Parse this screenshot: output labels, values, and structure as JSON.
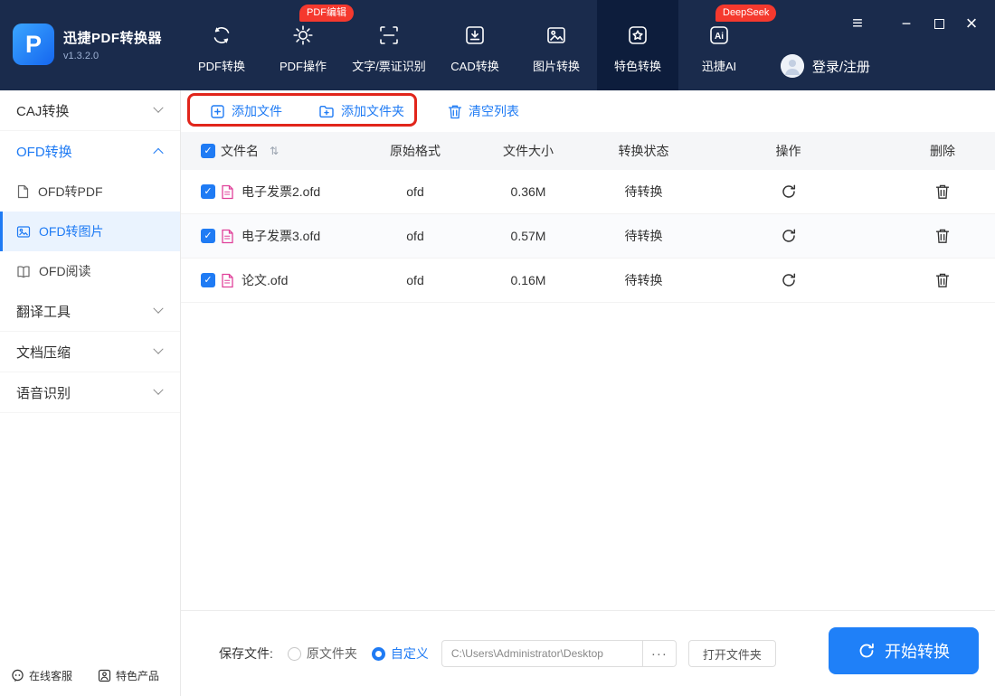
{
  "app": {
    "name": "迅捷PDF转换器",
    "version": "v1.3.2.0",
    "logo_letter": "P"
  },
  "header": {
    "nav": [
      {
        "label": "PDF转换"
      },
      {
        "label": "PDF操作",
        "badge": "PDF编辑"
      },
      {
        "label": "文字/票证识别"
      },
      {
        "label": "CAD转换"
      },
      {
        "label": "图片转换"
      },
      {
        "label": "特色转换",
        "active": true
      },
      {
        "label": "迅捷AI",
        "badge": "DeepSeek"
      }
    ],
    "login": "登录/注册"
  },
  "sidebar": {
    "groups": [
      {
        "label": "CAJ转换",
        "state": "collapsed"
      },
      {
        "label": "OFD转换",
        "state": "expanded",
        "children": [
          {
            "label": "OFD转PDF"
          },
          {
            "label": "OFD转图片",
            "active": true
          },
          {
            "label": "OFD阅读"
          }
        ]
      },
      {
        "label": "翻译工具",
        "state": "collapsed"
      },
      {
        "label": "文档压缩",
        "state": "collapsed"
      },
      {
        "label": "语音识别",
        "state": "collapsed"
      }
    ],
    "footer": [
      {
        "label": "在线客服"
      },
      {
        "label": "特色产品"
      }
    ]
  },
  "toolbar": {
    "add_file": "添加文件",
    "add_folder": "添加文件夹",
    "clear_list": "清空列表"
  },
  "table": {
    "columns": {
      "name": "文件名",
      "format": "原始格式",
      "size": "文件大小",
      "status": "转换状态",
      "action": "操作",
      "delete": "删除"
    },
    "rows": [
      {
        "name": "电子发票2.ofd",
        "format": "ofd",
        "size": "0.36M",
        "status": "待转换",
        "checked": true
      },
      {
        "name": "电子发票3.ofd",
        "format": "ofd",
        "size": "0.57M",
        "status": "待转换",
        "checked": true
      },
      {
        "name": "论文.ofd",
        "format": "ofd",
        "size": "0.16M",
        "status": "待转换",
        "checked": true
      }
    ]
  },
  "footer_bar": {
    "save_label": "保存文件:",
    "radio_original": "原文件夹",
    "radio_custom": "自定义",
    "path_value": "C:\\Users\\Administrator\\Desktop",
    "more_button": "···",
    "open_folder": "打开文件夹",
    "start_button": "开始转换"
  },
  "icons": {
    "check": "✓",
    "sort": "⇅",
    "menu": "≡",
    "minimize": "−",
    "close": "×"
  },
  "colors": {
    "header_bg": "#1a2b4c",
    "header_active_bg": "#0d1d3c",
    "accent_blue": "#1f7bf4",
    "badge_red": "#f5392e",
    "annotation_red": "#e1251b",
    "file_icon_pink": "#e0419a"
  }
}
